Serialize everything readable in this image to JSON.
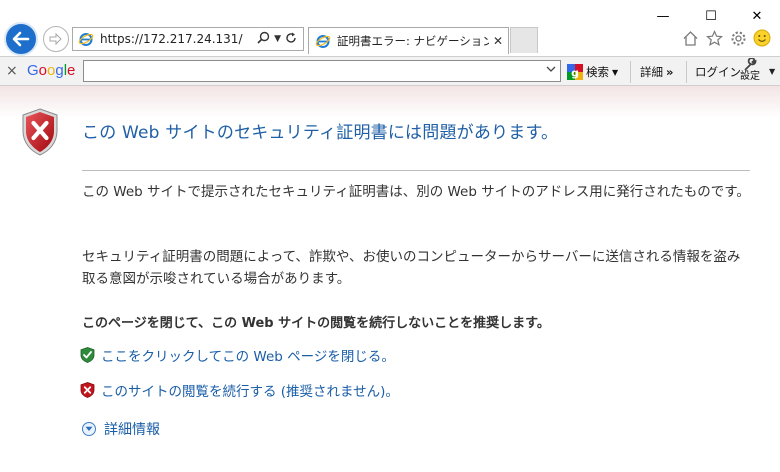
{
  "window": {
    "min_glyph": "—",
    "max_glyph": "☐",
    "close_glyph": "✕"
  },
  "address_bar": {
    "url": "https://172.217.24.131/"
  },
  "tab": {
    "title": "証明書エラー: ナビゲーションはブ...",
    "close_glyph": "✕"
  },
  "google_toolbar": {
    "close_glyph": "×",
    "logo_letters": [
      "G",
      "o",
      "o",
      "g",
      "l",
      "e"
    ],
    "logo_colors": [
      "#3369e8",
      "#d50f25",
      "#eeb211",
      "#3369e8",
      "#009925",
      "#d50f25"
    ],
    "search_value": "",
    "search_label": "検索",
    "more_label": "詳細",
    "more_glyph": "»",
    "login_label": "ログイン",
    "settings_label": "設定"
  },
  "page": {
    "headline": "この Web サイトのセキュリティ証明書には問題があります。",
    "paragraph1": "この Web サイトで提示されたセキュリティ証明書は、別の Web サイトのアドレス用に発行されたものです。",
    "paragraph2": "セキュリティ証明書の問題によって、詐欺や、お使いのコンピューターからサーバーに送信される情報を盗み取る意図が示唆されている場合があります。",
    "recommendation": "このページを閉じて、この Web サイトの閲覧を続行しないことを推奨します。",
    "close_link": "ここをクリックしてこの Web ページを閉じる。",
    "continue_link": "このサイトの閲覧を続行する (推奨されません)。",
    "more_info": "詳細情報"
  },
  "colors": {
    "accent": "#1f5fa6",
    "link": "#1a5ea8",
    "back_button": "#1e6fcb",
    "error_red": "#c4151c",
    "safe_green": "#2e8b3a"
  }
}
